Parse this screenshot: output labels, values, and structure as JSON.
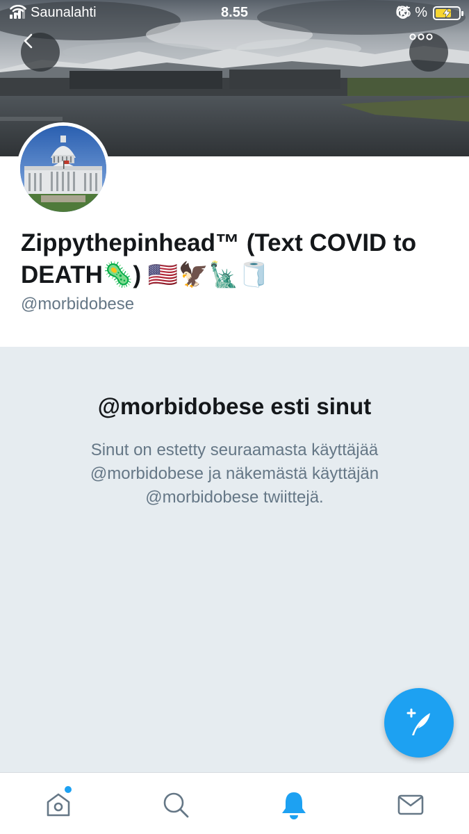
{
  "status_bar": {
    "carrier": "Saunalahti",
    "time": "8.55",
    "battery": "65 %",
    "battery_level": 0.65
  },
  "profile": {
    "display_name": "Zippythepinhead™ (Text COVID to DEATH🦠) 🇺🇸🦅🗽🧻",
    "handle": "@morbidobese"
  },
  "blocked": {
    "title": "@morbidobese esti sinut",
    "message": "Sinut on estetty seuraamasta käyttäjää @morbidobese ja näkemästä käyttäjän @morbidobese twiittejä."
  },
  "colors": {
    "accent": "#1da1f2",
    "text_primary": "#14171a",
    "text_secondary": "#657786",
    "blocked_background": "#e6ecf0",
    "battery_charging": "#f7d633"
  },
  "icons": {
    "back": "chevron-left-icon",
    "more": "more-horizontal-icon",
    "compose": "compose-tweet-icon",
    "home": "home-icon",
    "search": "search-icon",
    "notifications": "bell-icon",
    "messages": "mail-icon"
  },
  "tabs": [
    {
      "name": "home",
      "active": false,
      "has_dot": true
    },
    {
      "name": "search",
      "active": false
    },
    {
      "name": "notifications",
      "active": true
    },
    {
      "name": "messages",
      "active": false
    }
  ]
}
